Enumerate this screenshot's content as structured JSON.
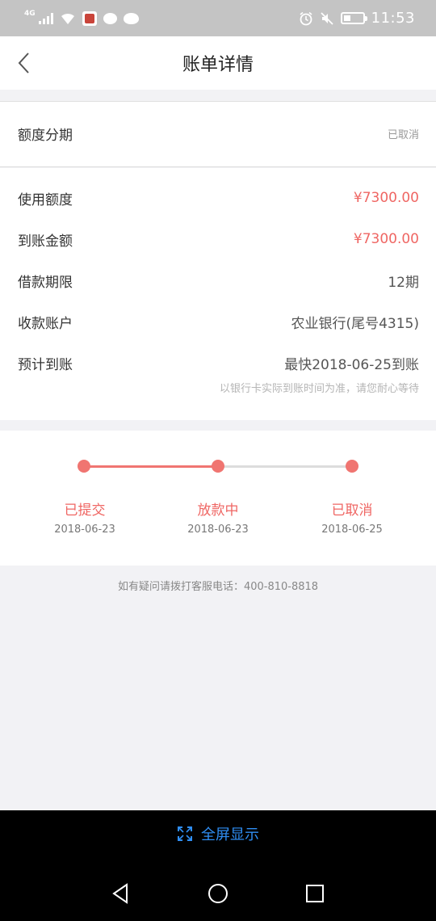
{
  "status_bar": {
    "network": "4G",
    "time": "11:53",
    "icons": [
      "signal-icon",
      "wifi-icon",
      "app-notification-icon",
      "message-icon",
      "wechat-icon",
      "alarm-icon",
      "mute-icon",
      "battery-icon"
    ]
  },
  "header": {
    "title": "账单详情",
    "back_icon": "chevron-left-icon"
  },
  "summary": {
    "label": "额度分期",
    "status": "已取消"
  },
  "details": [
    {
      "label": "使用额度",
      "value": "¥7300.00",
      "highlight": true
    },
    {
      "label": "到账金额",
      "value": "¥7300.00",
      "highlight": true
    },
    {
      "label": "借款期限",
      "value": "12期",
      "highlight": false
    },
    {
      "label": "收款账户",
      "value": "农业银行(尾号4315)",
      "highlight": false
    },
    {
      "label": "预计到账",
      "value": "最快2018-06-25到账",
      "highlight": false
    }
  ],
  "details_note": "以银行卡实际到账时间为准，请您耐心等待",
  "progress": {
    "steps": [
      {
        "label": "已提交",
        "date": "2018-06-23"
      },
      {
        "label": "放款中",
        "date": "2018-06-23"
      },
      {
        "label": "已取消",
        "date": "2018-06-25"
      }
    ],
    "colors": {
      "active": "#f07571",
      "inactive": "#dddddd"
    }
  },
  "service_text": "如有疑问请拨打客服电话：400-810-8818",
  "fullscreen_label": "全屏显示",
  "colors": {
    "accent": "#ef6663",
    "link": "#2f8ef4"
  }
}
